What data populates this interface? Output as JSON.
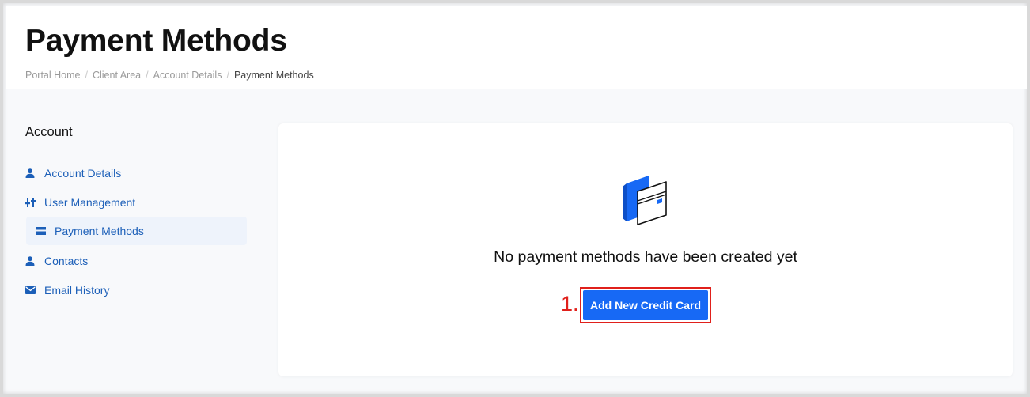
{
  "page": {
    "title": "Payment Methods"
  },
  "breadcrumb": {
    "items": [
      "Portal Home",
      "Client Area",
      "Account Details"
    ],
    "current": "Payment Methods",
    "separator": "/"
  },
  "sidebar": {
    "title": "Account",
    "items": [
      {
        "label": "Account Details",
        "icon": "user-icon"
      },
      {
        "label": "User Management",
        "icon": "sliders-icon"
      },
      {
        "label": "Payment Methods",
        "icon": "credit-card-icon",
        "active": true
      },
      {
        "label": "Contacts",
        "icon": "user-icon"
      },
      {
        "label": "Email History",
        "icon": "envelope-icon"
      }
    ]
  },
  "main": {
    "empty_message": "No payment methods have been created yet",
    "step_label": "1.",
    "add_button_label": "Add New Credit Card",
    "illustration_icon": "credit-card-illustration-icon"
  },
  "colors": {
    "accent": "#1769f5",
    "link": "#1c5fb8",
    "highlight": "#e0201b"
  }
}
